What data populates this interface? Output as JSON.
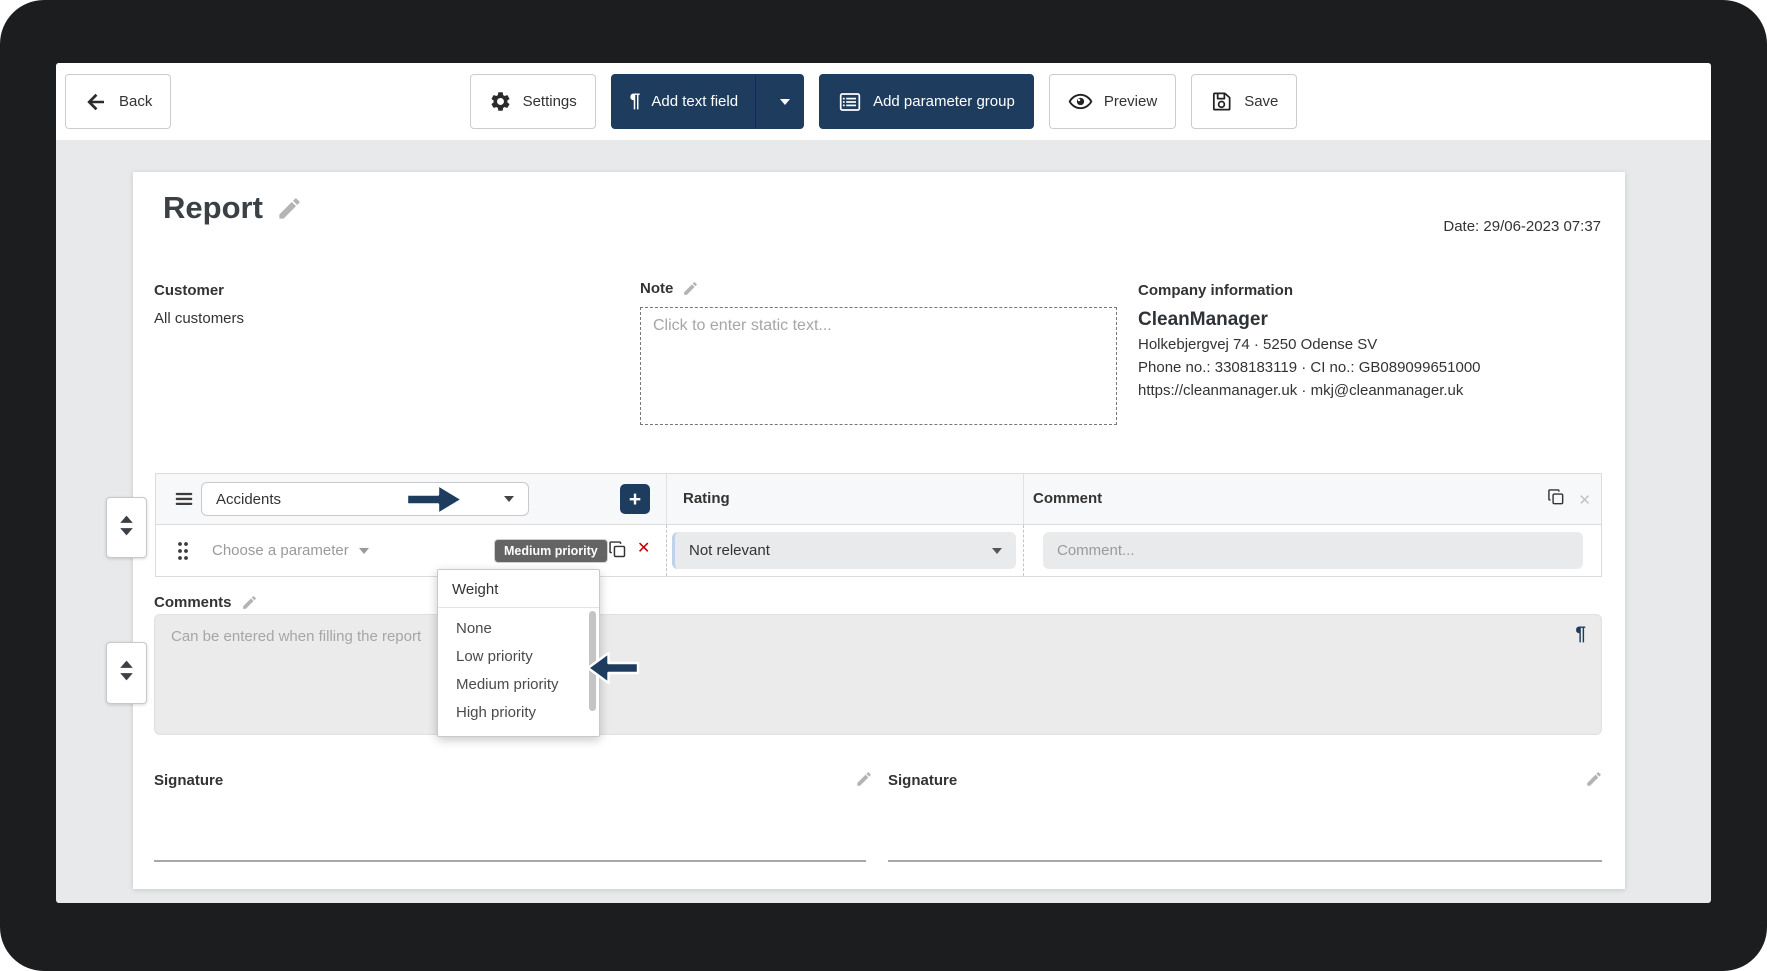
{
  "toolbar": {
    "back": "Back",
    "settings": "Settings",
    "add_text_field": "Add text field",
    "add_parameter_group": "Add parameter group",
    "preview": "Preview",
    "save": "Save"
  },
  "report": {
    "title": "Report",
    "date": "Date: 29/06-2023 07:37"
  },
  "customer": {
    "label": "Customer",
    "value": "All customers"
  },
  "note": {
    "label": "Note",
    "placeholder": "Click to enter static text..."
  },
  "company": {
    "label": "Company information",
    "name": "CleanManager",
    "address": "Holkebjergvej 74 · 5250 Odense SV",
    "phone_ci": "Phone no.: 3308183119 · CI no.: GB089099651000",
    "web_mail": "https://cleanmanager.uk · mkj@cleanmanager.uk"
  },
  "parameter_group": {
    "group_name": "Accidents",
    "rating_header": "Rating",
    "comment_header": "Comment",
    "parameter_placeholder": "Choose a parameter",
    "weight_badge": "Medium priority",
    "rating_value": "Not relevant",
    "comment_placeholder": "Comment..."
  },
  "weight_dropdown": {
    "header": "Weight",
    "options": [
      "None",
      "Low priority",
      "Medium priority",
      "High priority"
    ]
  },
  "comments": {
    "label": "Comments",
    "placeholder": "Can be entered when filling the report"
  },
  "signatures": [
    {
      "label": "Signature"
    },
    {
      "label": "Signature"
    }
  ],
  "glyphs": {
    "pilcrow": "¶",
    "plus": "+",
    "close": "✕"
  },
  "colors": {
    "navy": "#1e3d5e",
    "badge_gray": "#646464",
    "danger": "#c00000",
    "page_bg": "#e8e9ea"
  }
}
